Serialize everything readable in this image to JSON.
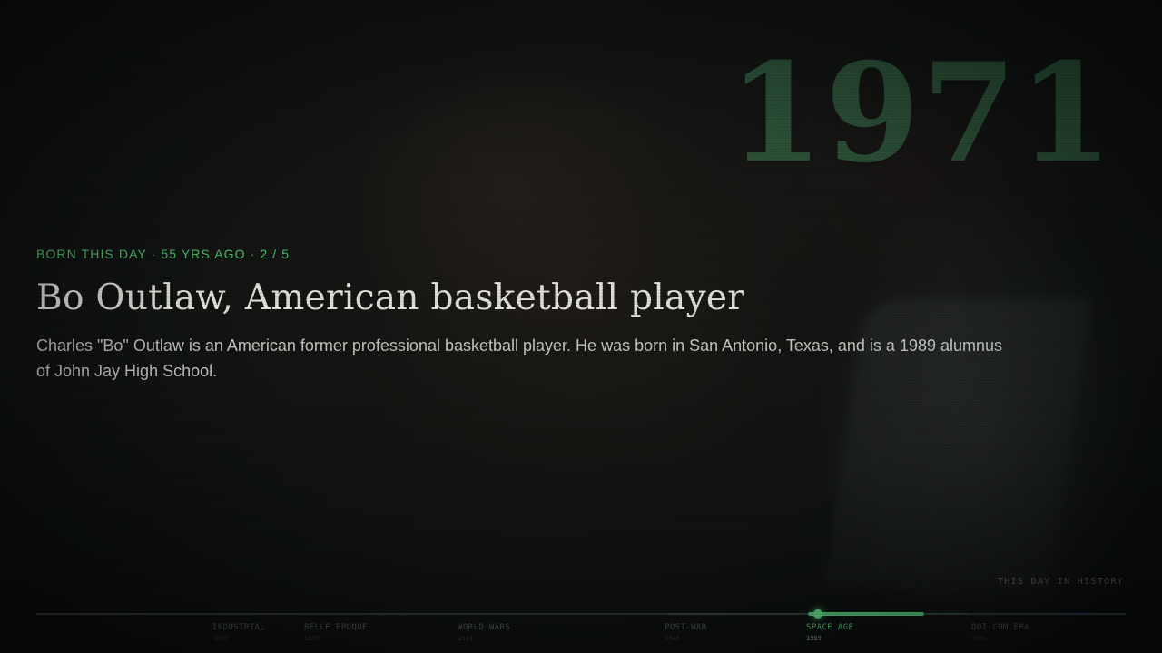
{
  "year": "1971",
  "eyebrow": "BORN THIS DAY · 55 YRS AGO · 2 / 5",
  "title": "Bo Outlaw, American basketball player",
  "description": "Charles \"Bo\" Outlaw is an American former professional basketball player. He was born in San Antonio, Texas, and is a 1989 alumnus of John Jay High School.",
  "section_label": "THIS DAY IN HISTORY",
  "timeline": {
    "eras": [
      {
        "name": "INDUSTRIAL",
        "year": "1800"
      },
      {
        "name": "BELLE EPOQUE",
        "year": "1870"
      },
      {
        "name": "WORLD WARS",
        "year": "1914"
      },
      {
        "name": "POST-WAR",
        "year": "1946"
      },
      {
        "name": "SPACE AGE",
        "year": "1969",
        "active": true
      },
      {
        "name": "DOT-COM ERA",
        "year": "1995"
      }
    ]
  },
  "colors": {
    "accent": "#54c274",
    "title": "#e4e4df",
    "year_watermark": "#3c7850"
  }
}
